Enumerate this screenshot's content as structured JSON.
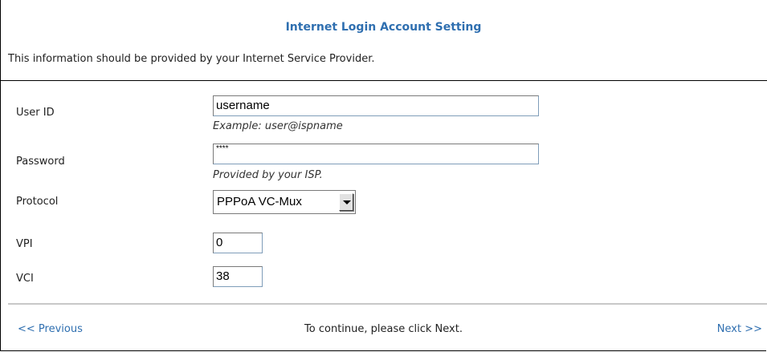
{
  "header": {
    "title": "Internet Login Account Setting",
    "info": "This information should be provided by your Internet Service Provider."
  },
  "form": {
    "user_id": {
      "label": "User ID",
      "value": "username",
      "hint": "Example: user@ispname"
    },
    "password": {
      "label": "Password",
      "value": "****",
      "hint": "Provided by your ISP."
    },
    "protocol": {
      "label": "Protocol",
      "value": "PPPoA VC-Mux"
    },
    "vpi": {
      "label": "VPI",
      "value": "0"
    },
    "vci": {
      "label": "VCI",
      "value": "38"
    }
  },
  "footer": {
    "previous": "<< Previous",
    "message": "To continue, please click Next.",
    "next": "Next >>"
  },
  "colors": {
    "title": "#2f6fb0",
    "link": "#2f6fb0"
  }
}
